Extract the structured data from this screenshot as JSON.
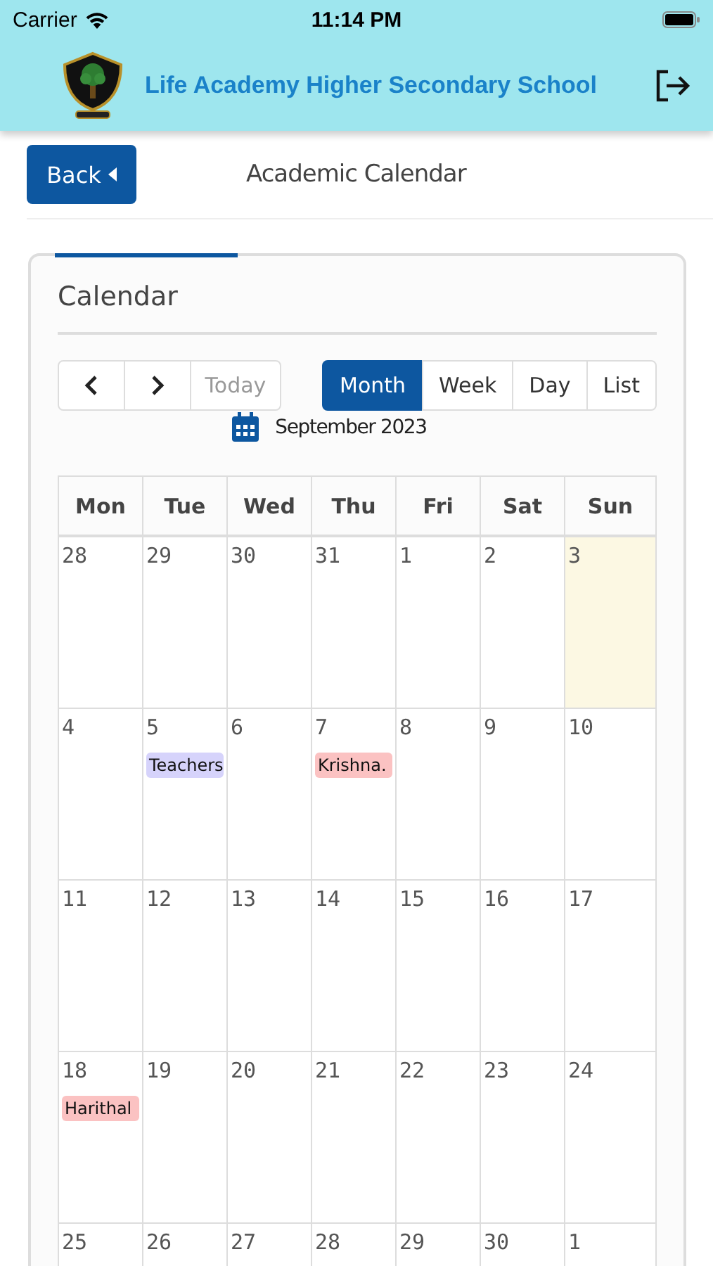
{
  "status_bar": {
    "carrier": "Carrier",
    "time": "11:14 PM"
  },
  "header": {
    "title": "Life Academy Higher Secondary School"
  },
  "page": {
    "back_button": "Back",
    "title": "Academic Calendar"
  },
  "calendar": {
    "title": "Calendar",
    "nav_buttons": [
      {
        "kind": "prev"
      },
      {
        "kind": "next"
      },
      {
        "kind": "today",
        "label": "Today",
        "disabled": true
      }
    ],
    "views": [
      {
        "label": "Month",
        "selected": true
      },
      {
        "label": "Week",
        "selected": false
      },
      {
        "label": "Day",
        "selected": false
      },
      {
        "label": "List",
        "selected": false
      }
    ],
    "month_label": "September 2023",
    "weekdays": [
      "Mon",
      "Tue",
      "Wed",
      "Thu",
      "Fri",
      "Sat",
      "Sun"
    ],
    "weeks": [
      [
        {
          "day": "28",
          "today": false
        },
        {
          "day": "29",
          "today": false
        },
        {
          "day": "30",
          "today": false
        },
        {
          "day": "31",
          "today": false
        },
        {
          "day": "1",
          "today": false
        },
        {
          "day": "2",
          "today": false
        },
        {
          "day": "3",
          "today": true
        }
      ],
      [
        {
          "day": "4",
          "today": false
        },
        {
          "day": "5",
          "today": false,
          "events": [
            {
              "title": "Teachers",
              "color": "#d6d3fb"
            }
          ]
        },
        {
          "day": "6",
          "today": false
        },
        {
          "day": "7",
          "today": false,
          "events": [
            {
              "title": "Krishna.",
              "color": "#fbc2c2"
            }
          ]
        },
        {
          "day": "8",
          "today": false
        },
        {
          "day": "9",
          "today": false
        },
        {
          "day": "10",
          "today": false
        }
      ],
      [
        {
          "day": "11",
          "today": false
        },
        {
          "day": "12",
          "today": false
        },
        {
          "day": "13",
          "today": false
        },
        {
          "day": "14",
          "today": false
        },
        {
          "day": "15",
          "today": false
        },
        {
          "day": "16",
          "today": false
        },
        {
          "day": "17",
          "today": false
        }
      ],
      [
        {
          "day": "18",
          "today": false,
          "events": [
            {
              "title": "Harithal",
              "color": "#fbc2c2"
            }
          ]
        },
        {
          "day": "19",
          "today": false
        },
        {
          "day": "20",
          "today": false
        },
        {
          "day": "21",
          "today": false
        },
        {
          "day": "22",
          "today": false
        },
        {
          "day": "23",
          "today": false
        },
        {
          "day": "24",
          "today": false
        }
      ],
      [
        {
          "day": "25",
          "today": false
        },
        {
          "day": "26",
          "today": false
        },
        {
          "day": "27",
          "today": false
        },
        {
          "day": "28",
          "today": false
        },
        {
          "day": "29",
          "today": false
        },
        {
          "day": "30",
          "today": false
        },
        {
          "day": "1",
          "today": false
        }
      ]
    ]
  }
}
